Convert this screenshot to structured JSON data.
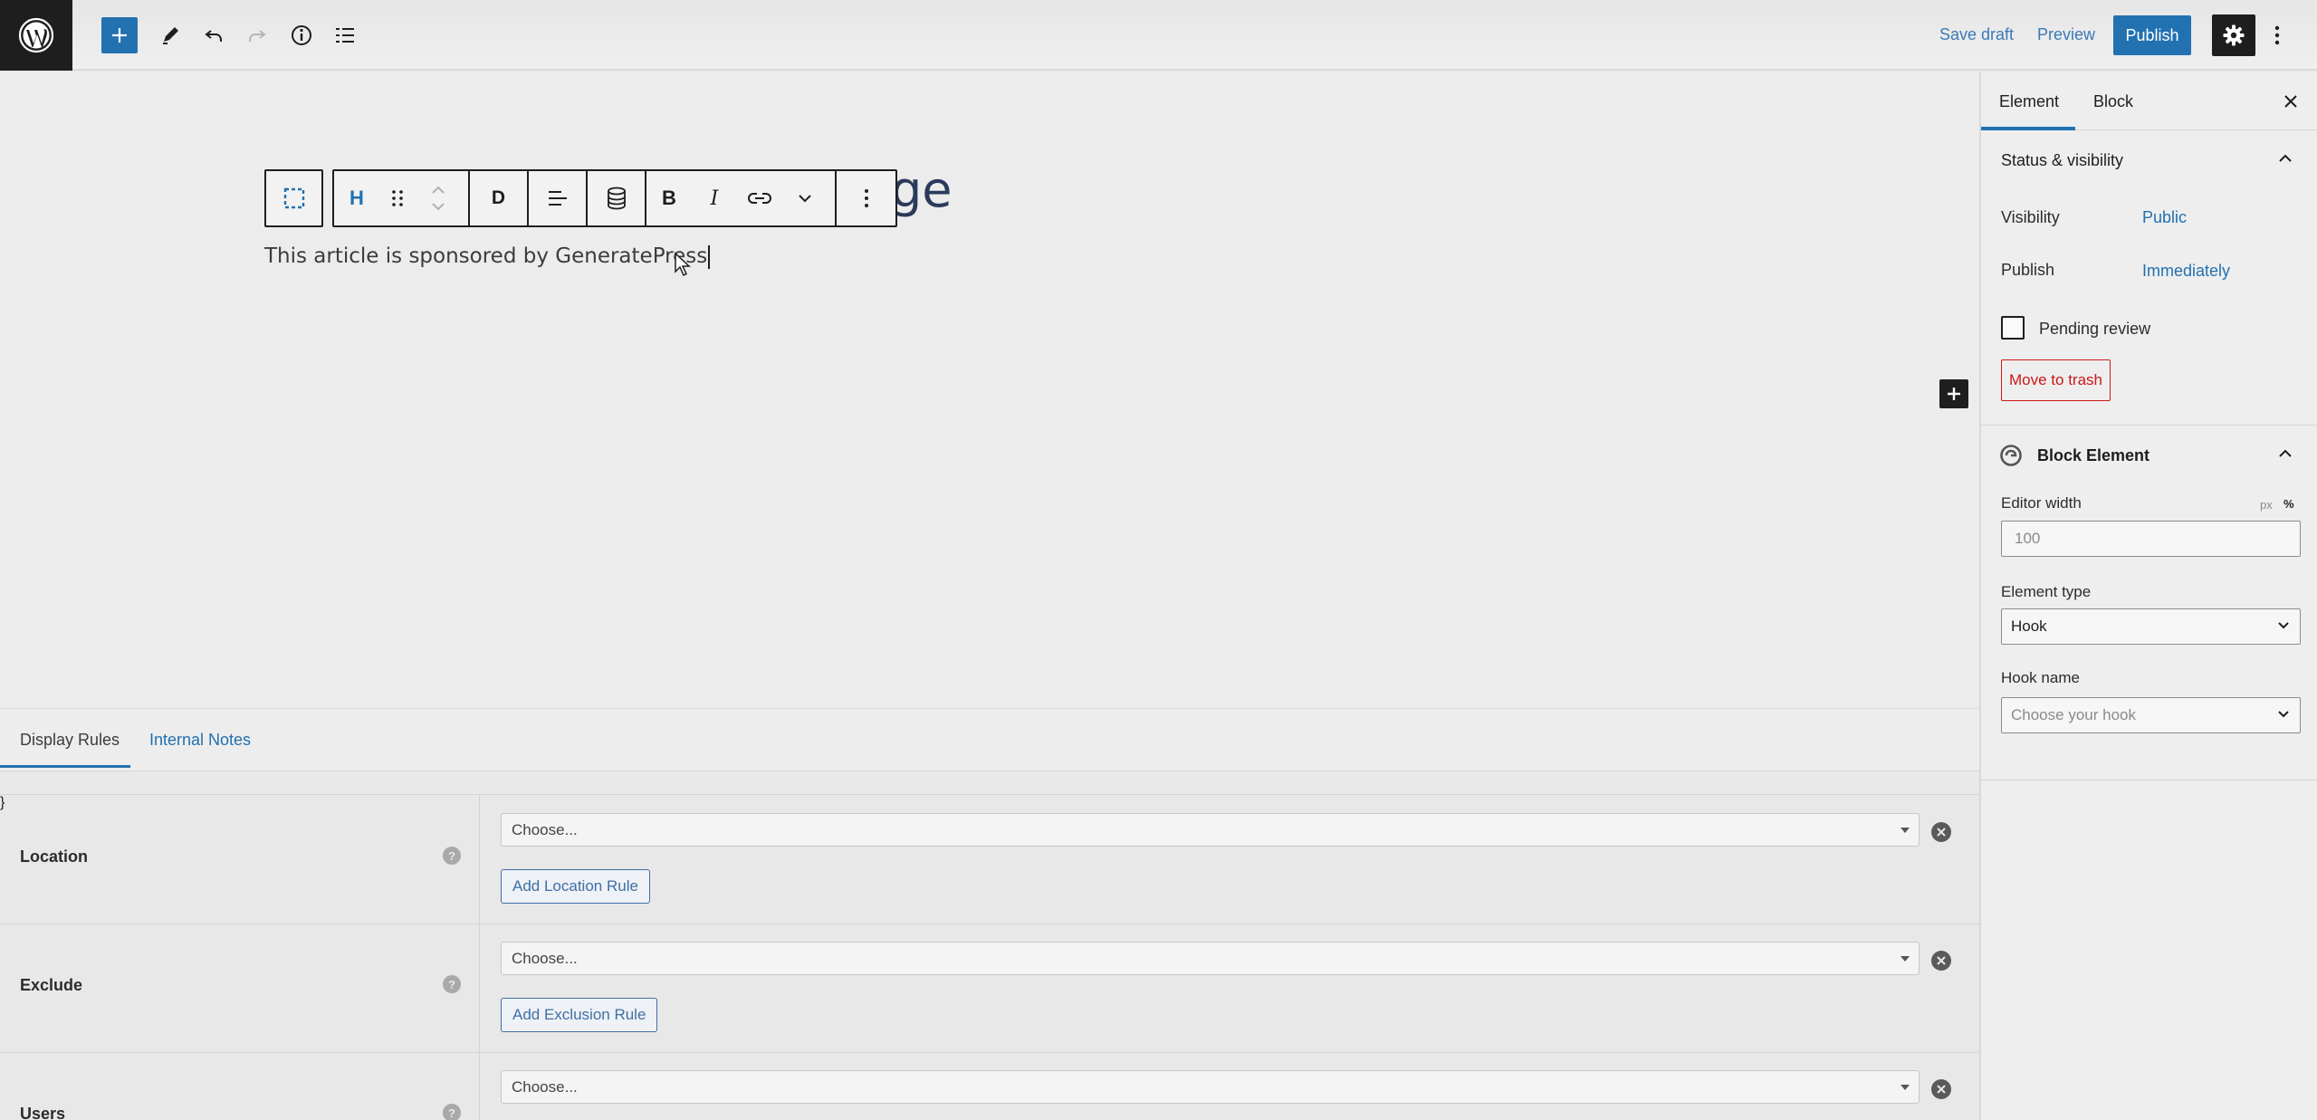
{
  "topbar": {
    "save_draft": "Save draft",
    "preview": "Preview",
    "publish": "Publish"
  },
  "editor": {
    "title_visible_fragment": "ge",
    "toolbar_heading_letter": "H",
    "toolbar_dynamic_letter": "D",
    "toolbar_bold_letter": "B",
    "toolbar_italic_letter": "I",
    "paragraph_text": "This article is sponsored by GeneratePress"
  },
  "meta": {
    "tabs": [
      "Display Rules",
      "Internal Notes"
    ],
    "active_tab": "Display Rules",
    "rules": [
      {
        "label": "Location",
        "select_value": "Choose...",
        "add_button": "Add Location Rule"
      },
      {
        "label": "Exclude",
        "select_value": "Choose...",
        "add_button": "Add Exclusion Rule"
      },
      {
        "label": "Users",
        "select_value": "Choose..."
      }
    ],
    "help_glyph": "?"
  },
  "sidebar": {
    "tabs": [
      "Element",
      "Block"
    ],
    "active_tab": "Element",
    "status": {
      "title": "Status & visibility",
      "visibility_label": "Visibility",
      "visibility_value": "Public",
      "publish_label": "Publish",
      "publish_value": "Immediately",
      "pending_review": "Pending review",
      "pending_review_checked": false,
      "trash": "Move to trash"
    },
    "block_element": {
      "title": "Block Element",
      "editor_width_label": "Editor width",
      "unit_px": "px",
      "unit_percent": "%",
      "editor_width_placeholder": "100",
      "element_type_label": "Element type",
      "element_type_value": "Hook",
      "hook_name_label": "Hook name",
      "hook_name_placeholder": "Choose your hook"
    }
  },
  "colors": {
    "accent": "#2271b1",
    "danger": "#cc1818",
    "dark": "#1e1e1e"
  }
}
